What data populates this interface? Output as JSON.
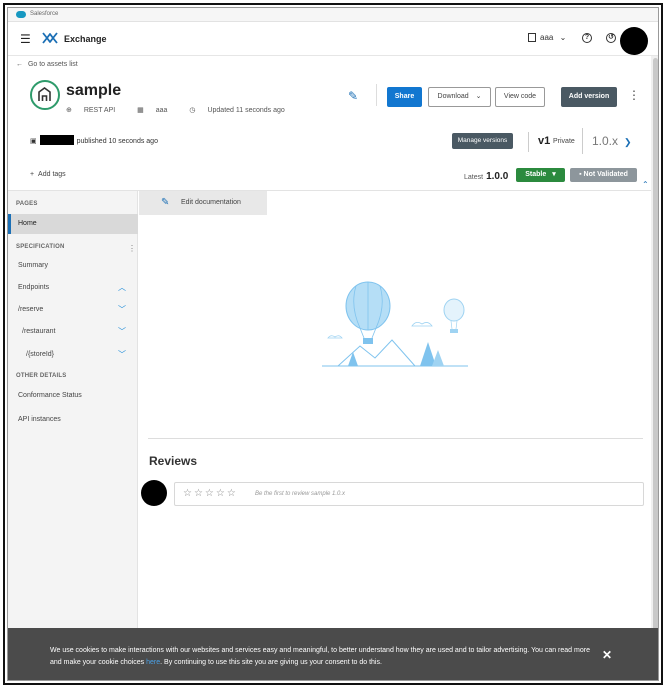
{
  "salesforce_strip": {
    "label": "Salesforce"
  },
  "header": {
    "app_name": "Exchange",
    "org_name": "aaa",
    "org_caret": "⌄"
  },
  "back_link": "Go to assets list",
  "asset": {
    "title": "sample",
    "type": "REST API",
    "org": "aaa",
    "updated": "Updated 11 seconds ago"
  },
  "actions": {
    "share": "Share",
    "download": "Download",
    "download_caret": "⌄",
    "view_code": "View code",
    "add_version": "Add version",
    "more": "⋮"
  },
  "publisher": {
    "text": "published 10 seconds ago"
  },
  "versions": {
    "manage": "Manage versions",
    "major": "v1",
    "visibility": "Private",
    "selected": "1.0.x",
    "latest_label": "Latest",
    "latest_value": "1.0.0",
    "stable": "Stable",
    "stable_caret": "▾",
    "not_validated": "Not Validated"
  },
  "tags": {
    "add": "Add tags"
  },
  "sidebar": {
    "pages_heading": "PAGES",
    "home": "Home",
    "spec_heading": "SPECIFICATION",
    "summary": "Summary",
    "endpoints": "Endpoints",
    "reserve": "/reserve",
    "restaurant": "/restaurant",
    "storeid": "/{storeId}",
    "other_heading": "OTHER DETAILS",
    "conformance": "Conformance Status",
    "api_instances": "API instances"
  },
  "main": {
    "edit_doc": "Edit documentation"
  },
  "reviews": {
    "title": "Reviews",
    "stars": "☆☆☆☆☆",
    "hint": "Be the first to review sample 1.0.x"
  },
  "cookie": {
    "text_1": "We use cookies to make interactions with our websites and services easy and meaningful, to better understand how they are used and to tailor advertising. You can read more and make your cookie choices",
    "link": "here",
    "text_2": ". By continuing to use this site you are giving us your consent to do this.",
    "close": "✕"
  },
  "colors": {
    "primary": "#1277d0",
    "dark_button": "#4a5963",
    "stable_green": "#2b8a3e",
    "asset_green": "#2e9b6b",
    "cookie_bg": "#4b4b4b"
  }
}
